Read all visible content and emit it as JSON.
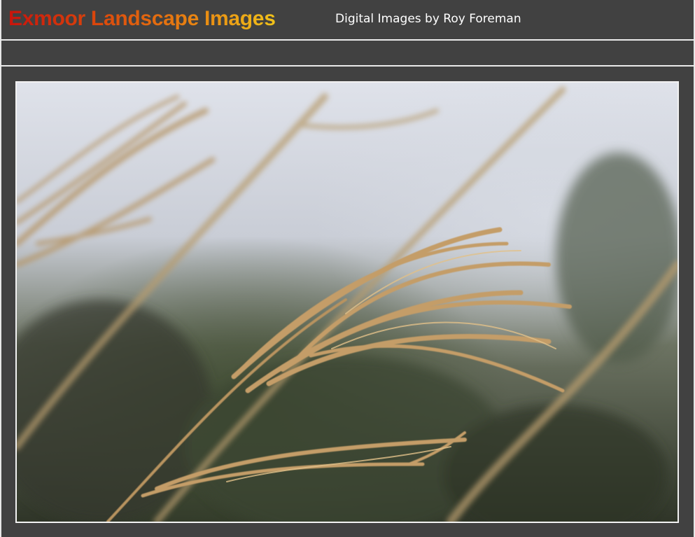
{
  "header": {
    "title": "Exmoor Landscape Images",
    "subtitle": "Digital Images by Roy Foreman"
  },
  "photo": {
    "subject": "grass-seedheads-photo"
  },
  "colors": {
    "background": "#414141",
    "divider": "#eaeaea",
    "title_gradient_start": "#c8140c",
    "title_gradient_end": "#f0c21a"
  }
}
